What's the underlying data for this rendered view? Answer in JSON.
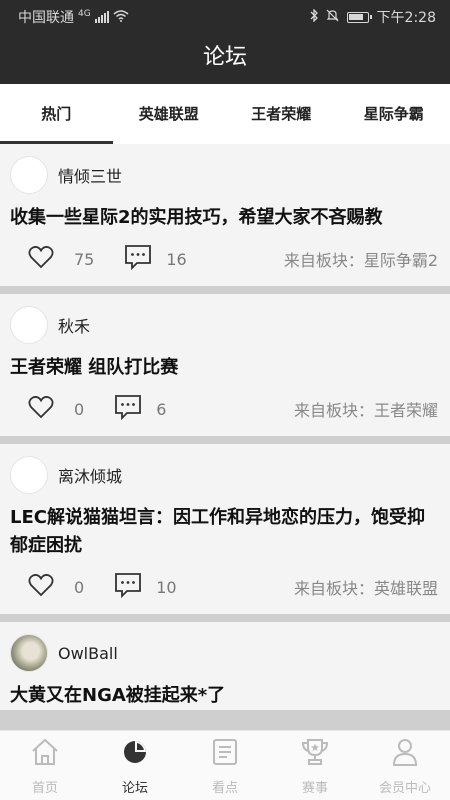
{
  "status": {
    "carrier": "中国联通",
    "network": "4G",
    "time": "下午2:28"
  },
  "header": {
    "title": "论坛"
  },
  "tabs": [
    {
      "label": "热门",
      "active": true
    },
    {
      "label": "英雄联盟"
    },
    {
      "label": "王者荣耀"
    },
    {
      "label": "星际争霸"
    }
  ],
  "posts": [
    {
      "author": "情倾三世",
      "title": "收集一些星际2的实用技巧，希望大家不吝赐教",
      "likes": "75",
      "comments": "16",
      "source": "来自板块：星际争霸2"
    },
    {
      "author": "秋禾",
      "title": "王者荣耀 组队打比赛",
      "likes": "0",
      "comments": "6",
      "source": "来自板块：王者荣耀"
    },
    {
      "author": "离沐倾城",
      "title": "LEC解说猫猫坦言：因工作和异地恋的压力，饱受抑郁症困扰",
      "likes": "0",
      "comments": "10",
      "source": "来自板块：英雄联盟"
    },
    {
      "author": "OwlBall",
      "title": "大黄又在NGA被挂起来*了"
    }
  ],
  "nav": [
    {
      "label": "首页",
      "icon": "home-icon"
    },
    {
      "label": "论坛",
      "icon": "forum-icon",
      "active": true
    },
    {
      "label": "看点",
      "icon": "news-icon"
    },
    {
      "label": "赛事",
      "icon": "trophy-icon"
    },
    {
      "label": "会员中心",
      "icon": "user-icon"
    }
  ],
  "colors": {
    "header_bg": "#2b2b2b",
    "inactive_nav": "#bbbbbb",
    "active_nav": "#333333"
  }
}
